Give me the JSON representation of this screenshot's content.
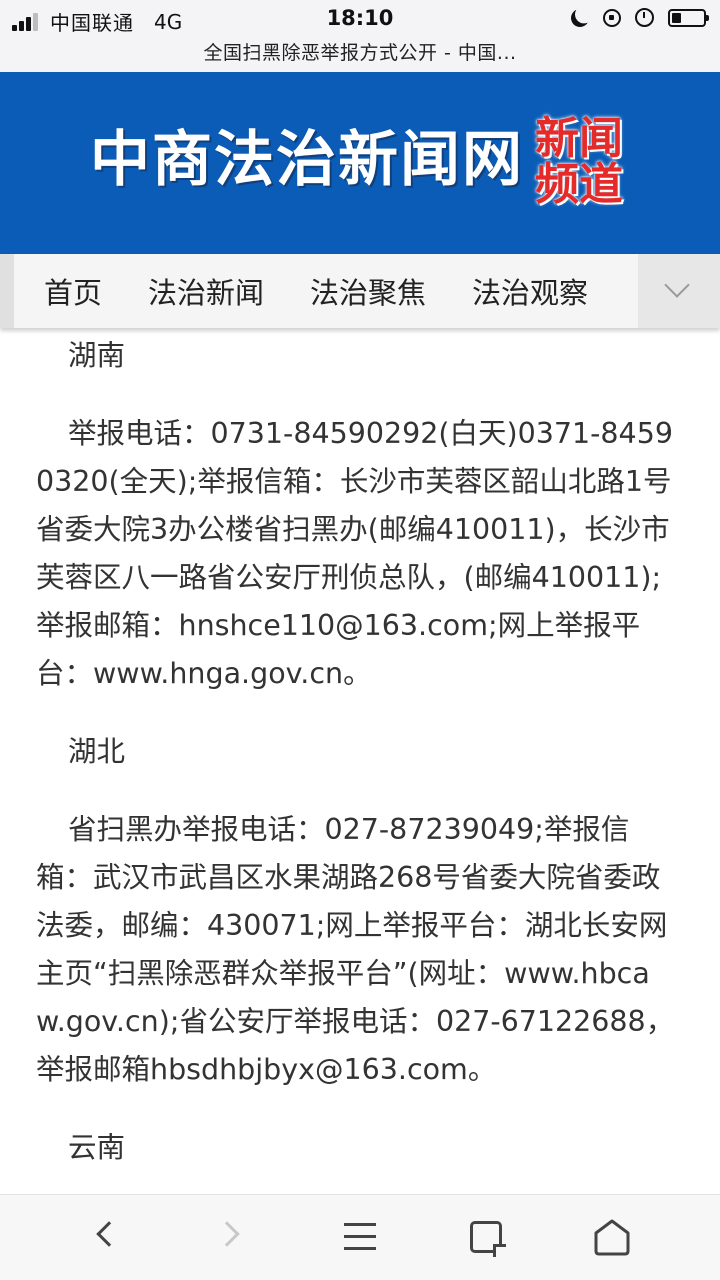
{
  "status_bar": {
    "carrier": "中国联通",
    "network": "4G",
    "time": "18:10",
    "signal_bars_filled": 3,
    "signal_bars_total": 4,
    "battery_level": 0.3
  },
  "browser": {
    "page_title": "全国扫黑除恶举报方式公开 - 中国..."
  },
  "banner": {
    "site_name": "中商法治新闻网",
    "channel_line1": "新闻",
    "channel_line2": "频道",
    "background_color": "#0b5cb6",
    "channel_color": "#e52a2a"
  },
  "nav": {
    "items": [
      {
        "label": "首页"
      },
      {
        "label": "法治新闻"
      },
      {
        "label": "法治聚焦"
      },
      {
        "label": "法治观察"
      }
    ],
    "more_icon": "chevron-down-icon"
  },
  "article": {
    "sections": [
      {
        "heading": "湖南",
        "body": "举报电话：0731-84590292(白天)0371-84590320(全天);举报信箱：长沙市芙蓉区韶山北路1号省委大院3办公楼省扫黑办(邮编410011)，长沙市芙蓉区八一路省公安厅刑侦总队，(邮编410011);举报邮箱：hnshce110@163.com;网上举报平台：www.hnga.gov.cn。"
      },
      {
        "heading": "湖北",
        "body": "省扫黑办举报电话：027-87239049;举报信箱：武汉市武昌区水果湖路268号省委大院省委政法委，邮编：430071;网上举报平台：湖北长安网主页“扫黑除恶群众举报平台”(网址：www.hbcaw.gov.cn);省公安厅举报电话：027-67122688，举报邮箱hbsdhbjbyx@163.com。"
      },
      {
        "heading": "云南",
        "body": ""
      }
    ]
  },
  "toolbar": {
    "back_icon": "back-arrow-icon",
    "forward_icon": "forward-arrow-icon",
    "menu_icon": "menu-icon",
    "tabs_icon": "tabs-icon",
    "home_icon": "home-icon"
  }
}
